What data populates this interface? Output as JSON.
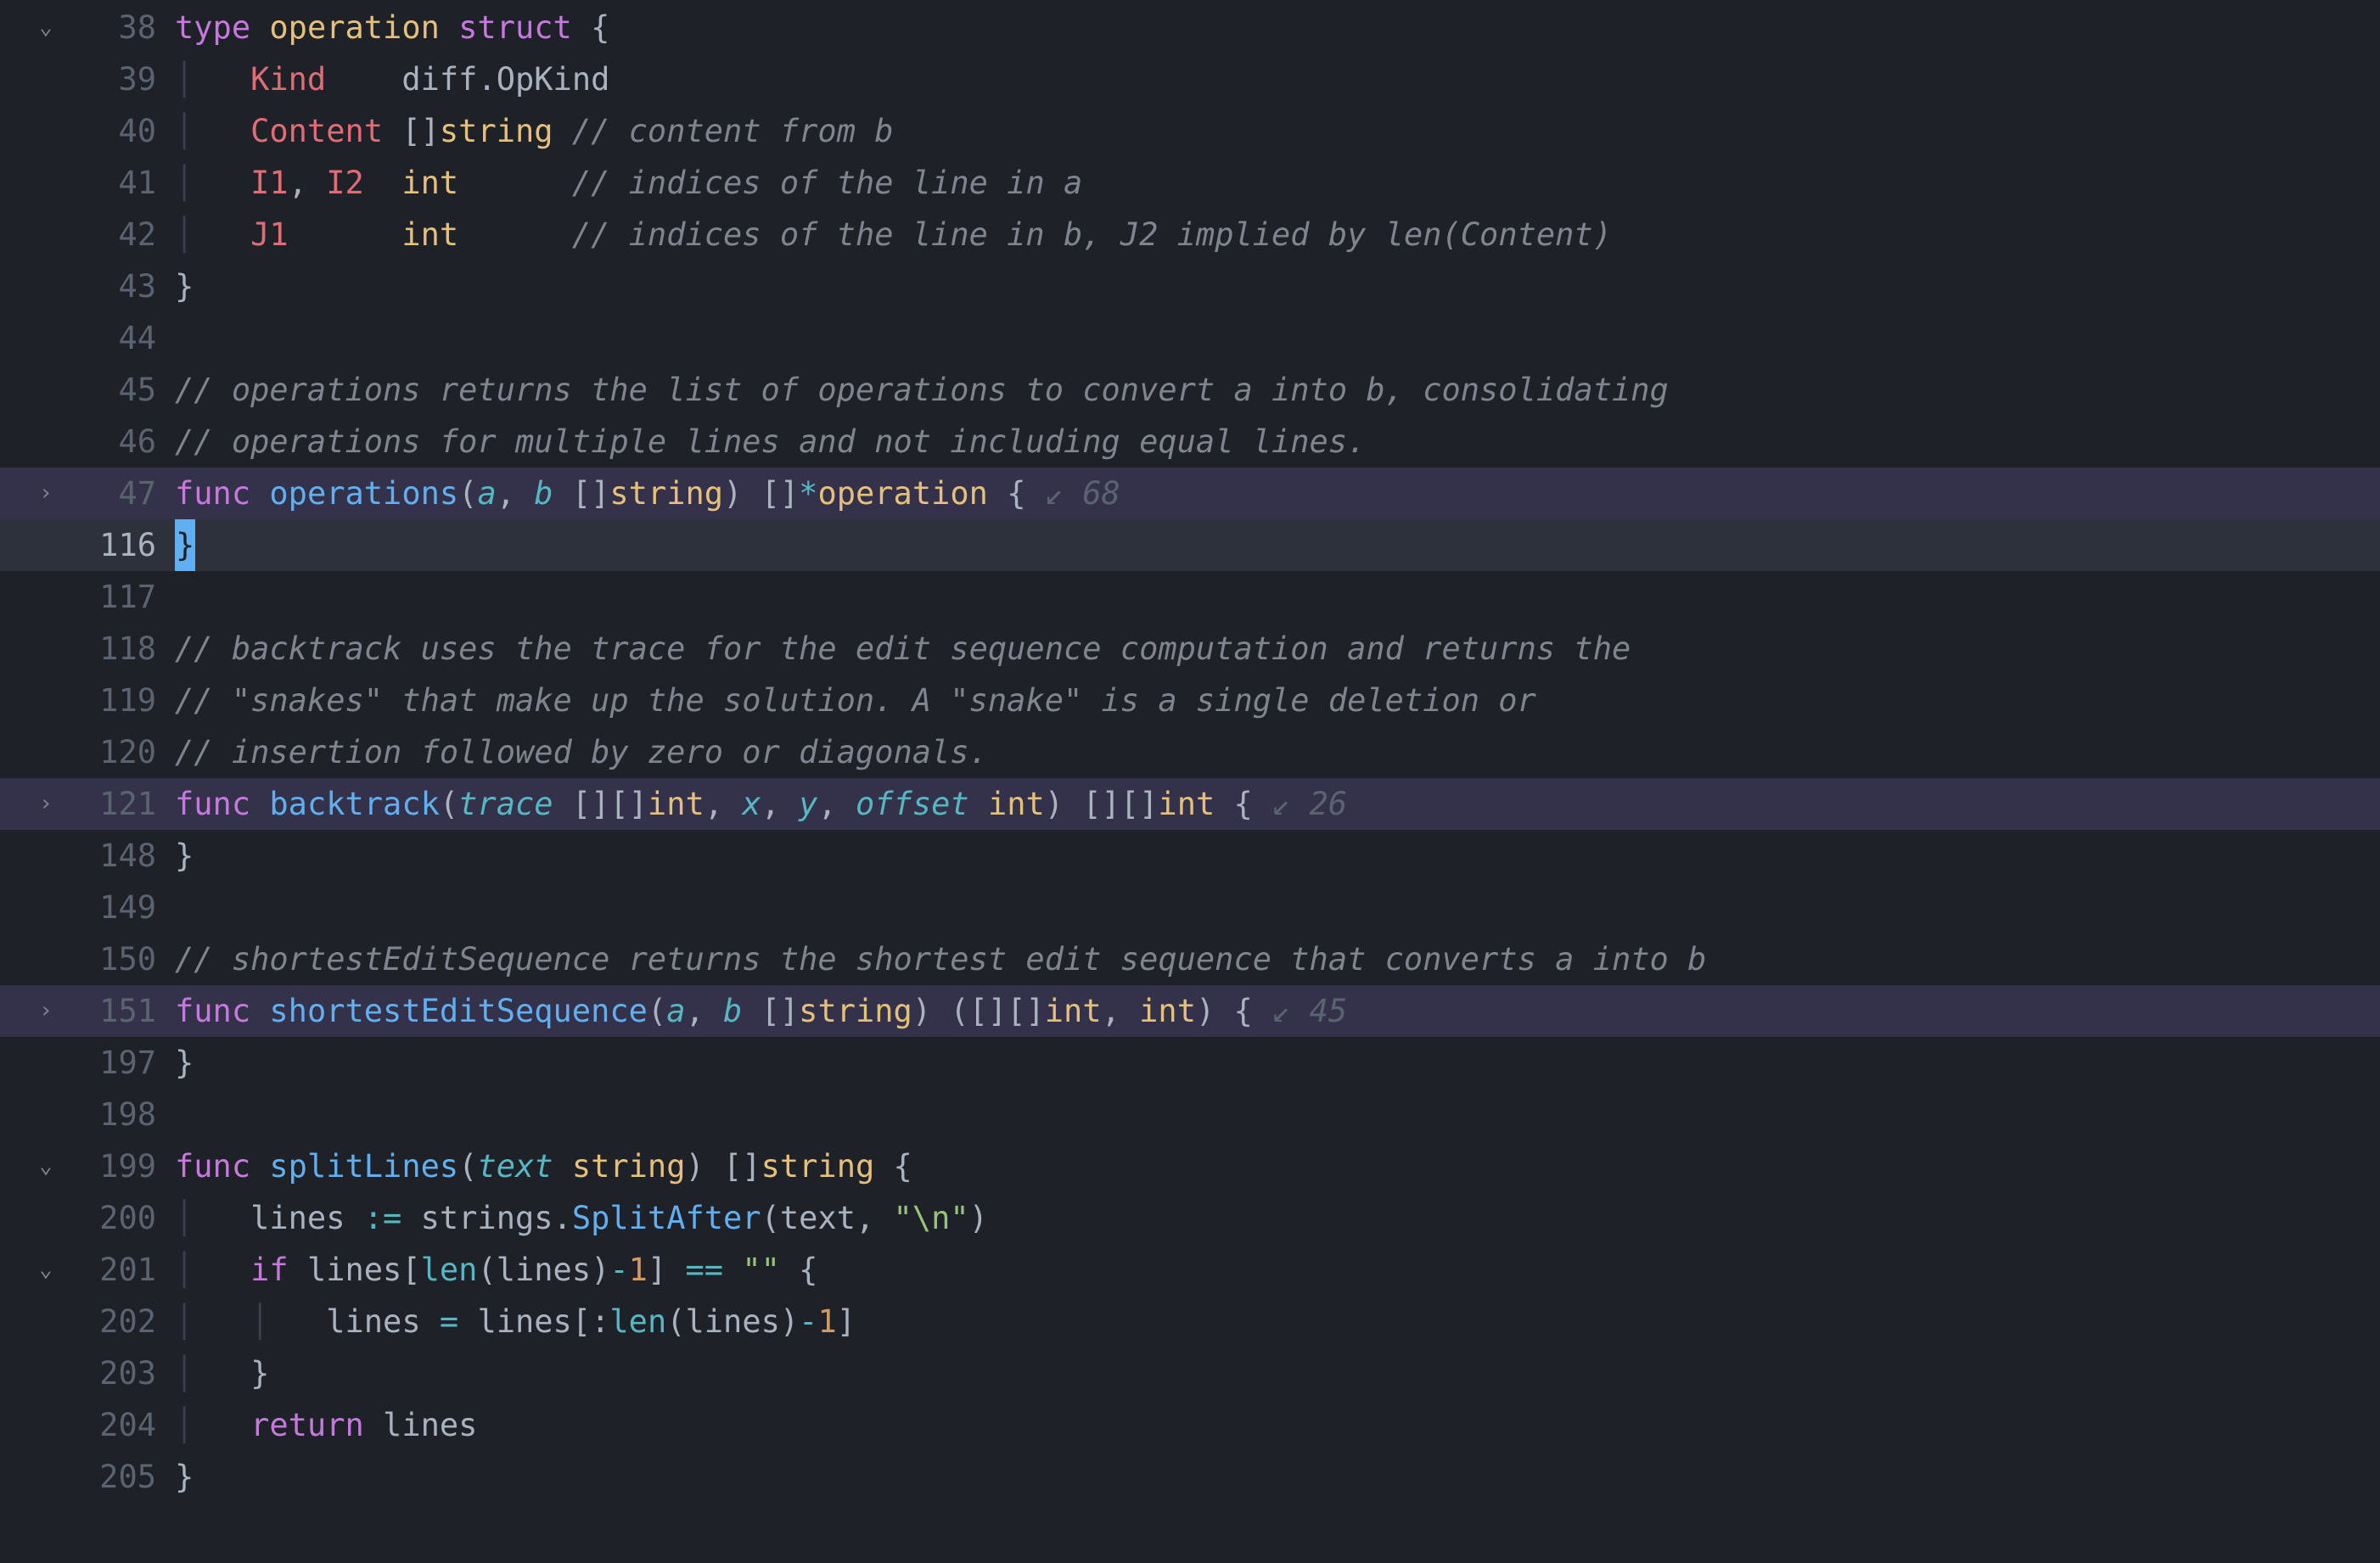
{
  "fold_open_glyph": "⌄",
  "fold_closed_glyph": "›",
  "fold_arrow_glyph": "↙",
  "lines": [
    {
      "n": 38,
      "fold": "open",
      "tokens": [
        [
          "c-keyword",
          "type "
        ],
        [
          "c-type",
          "operation "
        ],
        [
          "c-keyword",
          "struct "
        ],
        [
          "c-punct",
          "{"
        ]
      ]
    },
    {
      "n": 39,
      "guide": true,
      "tokens": [
        [
          "",
          "    "
        ],
        [
          "c-field",
          "Kind    "
        ],
        [
          "c-ident",
          "diff"
        ],
        [
          "c-punct",
          "."
        ],
        [
          "c-ident",
          "OpKind"
        ]
      ]
    },
    {
      "n": 40,
      "guide": true,
      "tokens": [
        [
          "",
          "    "
        ],
        [
          "c-field",
          "Content "
        ],
        [
          "c-punct",
          "[]"
        ],
        [
          "c-type",
          "string "
        ],
        [
          "c-comment",
          "// content from b"
        ]
      ]
    },
    {
      "n": 41,
      "guide": true,
      "tokens": [
        [
          "",
          "    "
        ],
        [
          "c-field",
          "I1"
        ],
        [
          "c-punct",
          ", "
        ],
        [
          "c-field",
          "I2  "
        ],
        [
          "c-type",
          "int      "
        ],
        [
          "c-comment",
          "// indices of the line in a"
        ]
      ]
    },
    {
      "n": 42,
      "guide": true,
      "tokens": [
        [
          "",
          "    "
        ],
        [
          "c-field",
          "J1      "
        ],
        [
          "c-type",
          "int      "
        ],
        [
          "c-comment",
          "// indices of the line in b, J2 implied by len(Content)"
        ]
      ]
    },
    {
      "n": 43,
      "tokens": [
        [
          "c-punct",
          "}"
        ]
      ]
    },
    {
      "n": 44,
      "tokens": []
    },
    {
      "n": 45,
      "tokens": [
        [
          "c-comment",
          "// operations returns the list of operations to convert a into b, consolidating"
        ]
      ]
    },
    {
      "n": 46,
      "tokens": [
        [
          "c-comment",
          "// operations for multiple lines and not including equal lines."
        ]
      ]
    },
    {
      "n": 47,
      "fold": "closed",
      "folded_bg": true,
      "fold_count": "68",
      "tokens": [
        [
          "c-keyword",
          "func "
        ],
        [
          "c-func",
          "operations"
        ],
        [
          "c-punct",
          "("
        ],
        [
          "c-param",
          "a"
        ],
        [
          "c-punct",
          ", "
        ],
        [
          "c-param",
          "b "
        ],
        [
          "c-punct",
          "[]"
        ],
        [
          "c-type",
          "string"
        ],
        [
          "c-punct",
          ") []"
        ],
        [
          "c-op",
          "*"
        ],
        [
          "c-type",
          "operation "
        ],
        [
          "c-punct",
          "{ "
        ]
      ]
    },
    {
      "n": 116,
      "current": true,
      "tokens": [],
      "cursor_brace": "}"
    },
    {
      "n": 117,
      "tokens": []
    },
    {
      "n": 118,
      "tokens": [
        [
          "c-comment",
          "// backtrack uses the trace for the edit sequence computation and returns the"
        ]
      ]
    },
    {
      "n": 119,
      "tokens": [
        [
          "c-comment",
          "// \"snakes\" that make up the solution. A \"snake\" is a single deletion or"
        ]
      ]
    },
    {
      "n": 120,
      "tokens": [
        [
          "c-comment",
          "// insertion followed by zero or diagonals."
        ]
      ]
    },
    {
      "n": 121,
      "fold": "closed",
      "folded_bg": true,
      "fold_count": "26",
      "tokens": [
        [
          "c-keyword",
          "func "
        ],
        [
          "c-func",
          "backtrack"
        ],
        [
          "c-punct",
          "("
        ],
        [
          "c-param",
          "trace "
        ],
        [
          "c-punct",
          "[][]"
        ],
        [
          "c-type",
          "int"
        ],
        [
          "c-punct",
          ", "
        ],
        [
          "c-param",
          "x"
        ],
        [
          "c-punct",
          ", "
        ],
        [
          "c-param",
          "y"
        ],
        [
          "c-punct",
          ", "
        ],
        [
          "c-param",
          "offset "
        ],
        [
          "c-type",
          "int"
        ],
        [
          "c-punct",
          ") [][]"
        ],
        [
          "c-type",
          "int "
        ],
        [
          "c-punct",
          "{ "
        ]
      ]
    },
    {
      "n": 148,
      "tokens": [
        [
          "c-punct",
          "}"
        ]
      ]
    },
    {
      "n": 149,
      "tokens": []
    },
    {
      "n": 150,
      "tokens": [
        [
          "c-comment",
          "// shortestEditSequence returns the shortest edit sequence that converts a into b"
        ]
      ]
    },
    {
      "n": 151,
      "fold": "closed",
      "folded_bg": true,
      "fold_count": "45",
      "tokens": [
        [
          "c-keyword",
          "func "
        ],
        [
          "c-func",
          "shortestEditSequence"
        ],
        [
          "c-punct",
          "("
        ],
        [
          "c-param",
          "a"
        ],
        [
          "c-punct",
          ", "
        ],
        [
          "c-param",
          "b "
        ],
        [
          "c-punct",
          "[]"
        ],
        [
          "c-type",
          "string"
        ],
        [
          "c-punct",
          ") ([][]"
        ],
        [
          "c-type",
          "int"
        ],
        [
          "c-punct",
          ", "
        ],
        [
          "c-type",
          "int"
        ],
        [
          "c-punct",
          ") { "
        ]
      ]
    },
    {
      "n": 197,
      "tokens": [
        [
          "c-punct",
          "}"
        ]
      ]
    },
    {
      "n": 198,
      "tokens": []
    },
    {
      "n": 199,
      "fold": "open",
      "tokens": [
        [
          "c-keyword",
          "func "
        ],
        [
          "c-func",
          "splitLines"
        ],
        [
          "c-punct",
          "("
        ],
        [
          "c-param",
          "text "
        ],
        [
          "c-type",
          "string"
        ],
        [
          "c-punct",
          ") []"
        ],
        [
          "c-type",
          "string "
        ],
        [
          "c-punct",
          "{"
        ]
      ]
    },
    {
      "n": 200,
      "guide": true,
      "tokens": [
        [
          "",
          "    "
        ],
        [
          "c-ident",
          "lines "
        ],
        [
          "c-op",
          ":= "
        ],
        [
          "c-ident",
          "strings"
        ],
        [
          "c-punct",
          "."
        ],
        [
          "c-func",
          "SplitAfter"
        ],
        [
          "c-punct",
          "("
        ],
        [
          "c-ident",
          "text"
        ],
        [
          "c-punct",
          ", "
        ],
        [
          "c-string",
          "\"\\n\""
        ],
        [
          "c-punct",
          ")"
        ]
      ]
    },
    {
      "n": 201,
      "fold": "open",
      "guide": true,
      "tokens": [
        [
          "",
          "    "
        ],
        [
          "c-keyword",
          "if "
        ],
        [
          "c-ident",
          "lines"
        ],
        [
          "c-punct",
          "["
        ],
        [
          "c-builtin",
          "len"
        ],
        [
          "c-punct",
          "("
        ],
        [
          "c-ident",
          "lines"
        ],
        [
          "c-punct",
          ")"
        ],
        [
          "c-op",
          "-"
        ],
        [
          "c-num",
          "1"
        ],
        [
          "c-punct",
          "] "
        ],
        [
          "c-op",
          "== "
        ],
        [
          "c-string",
          "\"\" "
        ],
        [
          "c-punct",
          "{"
        ]
      ]
    },
    {
      "n": 202,
      "guide": true,
      "guide2": true,
      "tokens": [
        [
          "",
          "        "
        ],
        [
          "c-ident",
          "lines "
        ],
        [
          "c-op",
          "= "
        ],
        [
          "c-ident",
          "lines"
        ],
        [
          "c-punct",
          "[:"
        ],
        [
          "c-builtin",
          "len"
        ],
        [
          "c-punct",
          "("
        ],
        [
          "c-ident",
          "lines"
        ],
        [
          "c-punct",
          ")"
        ],
        [
          "c-op",
          "-"
        ],
        [
          "c-num",
          "1"
        ],
        [
          "c-punct",
          "]"
        ]
      ]
    },
    {
      "n": 203,
      "guide": true,
      "tokens": [
        [
          "",
          "    "
        ],
        [
          "c-punct",
          "}"
        ]
      ]
    },
    {
      "n": 204,
      "guide": true,
      "tokens": [
        [
          "",
          "    "
        ],
        [
          "c-keyword",
          "return "
        ],
        [
          "c-ident",
          "lines"
        ]
      ]
    },
    {
      "n": 205,
      "tokens": [
        [
          "c-punct",
          "}"
        ]
      ]
    }
  ]
}
